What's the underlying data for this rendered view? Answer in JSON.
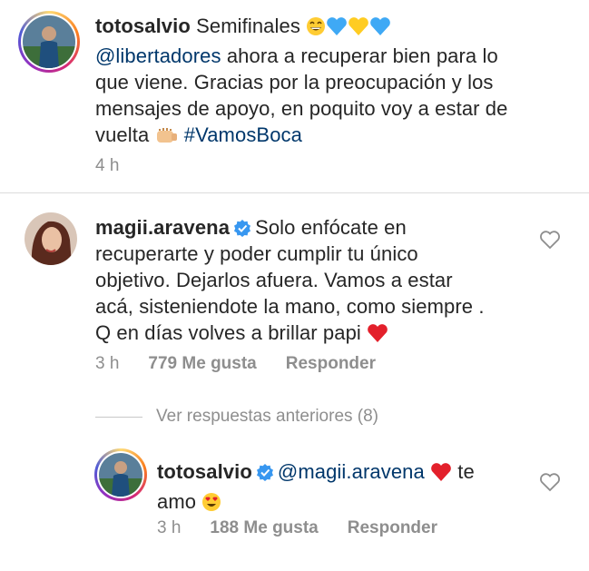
{
  "comments": [
    {
      "username": "totosalvio",
      "text_parts": [
        "Semifinales",
        "@libertadores",
        "ahora a recuperar bien para lo",
        "que viene. Gracias por la preocupación y los",
        "mensajes de apoyo, en poquito voy a estar de",
        "vuelta",
        "#VamosBoca"
      ],
      "time": "4 h",
      "verified": false,
      "emojis": [
        "grinning-face",
        "blue-heart",
        "yellow-heart",
        "blue-heart",
        "fist-bump"
      ]
    },
    {
      "username": "magii.aravena",
      "verified": true,
      "lines": [
        "Solo enfócate en",
        "recuperarte y poder cumplir tu único",
        "objetivo. Dejarlos afuera. Vamos a estar",
        "acá, sisteniendote la mano, como siempre .",
        "Q en días volves a brillar papi"
      ],
      "time": "3 h",
      "likes": "779 Me gusta",
      "reply_label": "Responder",
      "emojis": [
        "red-heart"
      ]
    }
  ],
  "view_replies_label": "Ver respuestas anteriores (8)",
  "reply": {
    "username": "totosalvio",
    "verified": true,
    "mention": "@magii.aravena",
    "text_after": "te",
    "line2": "amo",
    "time": "3 h",
    "likes": "188 Me gusta",
    "reply_label": "Responder",
    "emojis": [
      "red-heart",
      "heart-eyes"
    ]
  },
  "colors": {
    "link": "#00376b",
    "secondary_text": "#8e8e8e",
    "verified_badge": "#3897f0",
    "heart": "#ed4956",
    "divider": "#dbdbdb"
  }
}
